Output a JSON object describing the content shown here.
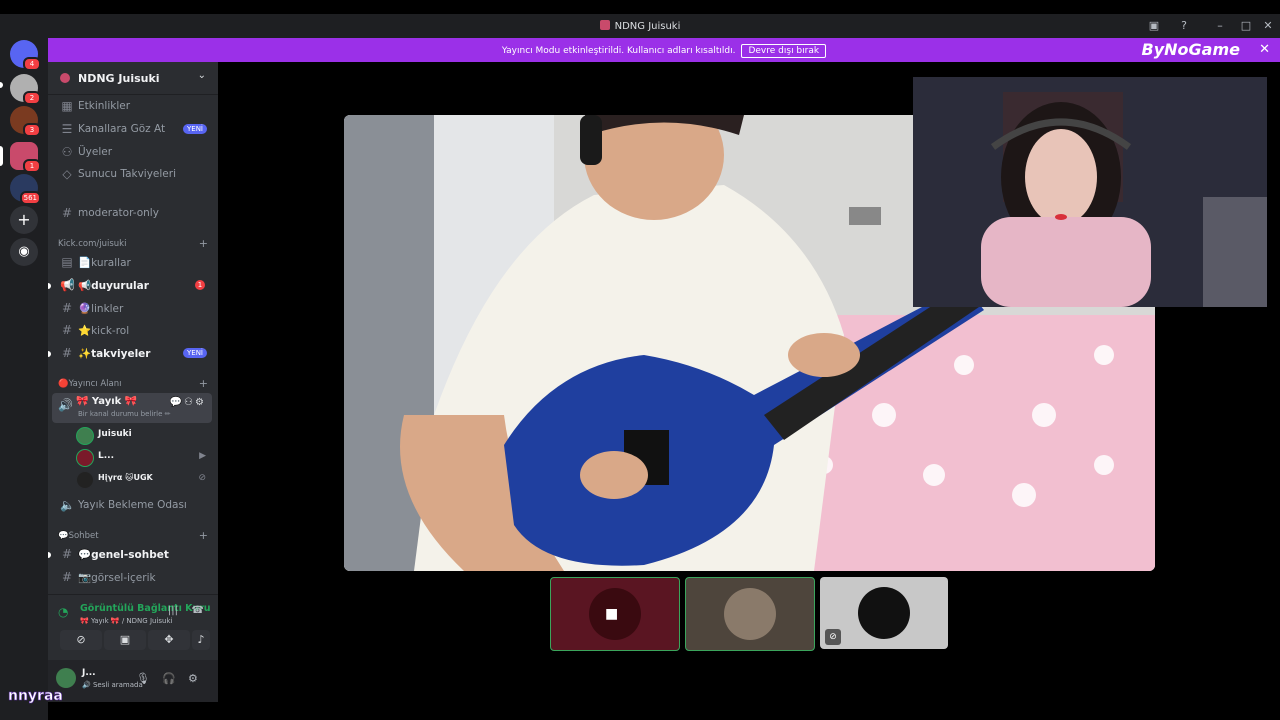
{
  "window": {
    "title": "NDNG Juisuki"
  },
  "banner": {
    "message": "Yayıncı Modu etkinleştirildi. Kullanıcı adları kısaltıldı.",
    "button": "Devre dışı bırak",
    "brand": "ByNoGame"
  },
  "rail": {
    "badges": [
      "4",
      "2",
      "3",
      "1",
      "561"
    ]
  },
  "guild": {
    "name": "NDNG Juisuki"
  },
  "nav": {
    "events": "Etkinlikler",
    "browse": "Kanallara Göz At",
    "browse_badge": "YENİ",
    "members": "Üyeler",
    "boosts": "Sunucu Takviyeleri"
  },
  "channels": {
    "moderator": "moderator-only",
    "cat_kick": "Kick.com/juisuki",
    "kurallar": "📄kurallar",
    "duyurular": "📢duyurular",
    "duyurular_badge": "1",
    "linkler": "🔮linkler",
    "kickrol": "⭐kick-rol",
    "takviyeler": "✨takviyeler",
    "takviyeler_badge": "YENİ",
    "cat_yayinci": "🔴Yayıncı Alanı",
    "yayik": "🎀 Yayık 🎀",
    "yayik_status": "Bir kanal durumu belirle ✏",
    "bekleme": "Yayık Bekleme Odası",
    "cat_sohbet": "💬Sohbet",
    "genel": "💬genel-sohbet",
    "gorsel": "📷görsel-içerik"
  },
  "voice_users": [
    {
      "name": "Juisuki"
    },
    {
      "name": "L..."
    },
    {
      "name": "Ηįγrα 🐱UGK"
    }
  ],
  "rtc": {
    "status": "Görüntülü Bağlantı Kuru",
    "location": "🎀 Yayık 🎀 / NDNG Juisuki"
  },
  "user": {
    "name": "J...",
    "status": "🔊 Sesli aramada"
  },
  "overlay_name": "nnyraa",
  "colors": {
    "accent": "#9b30e8",
    "online": "#23a55a",
    "danger": "#f23f43",
    "blurple": "#5865f2"
  }
}
